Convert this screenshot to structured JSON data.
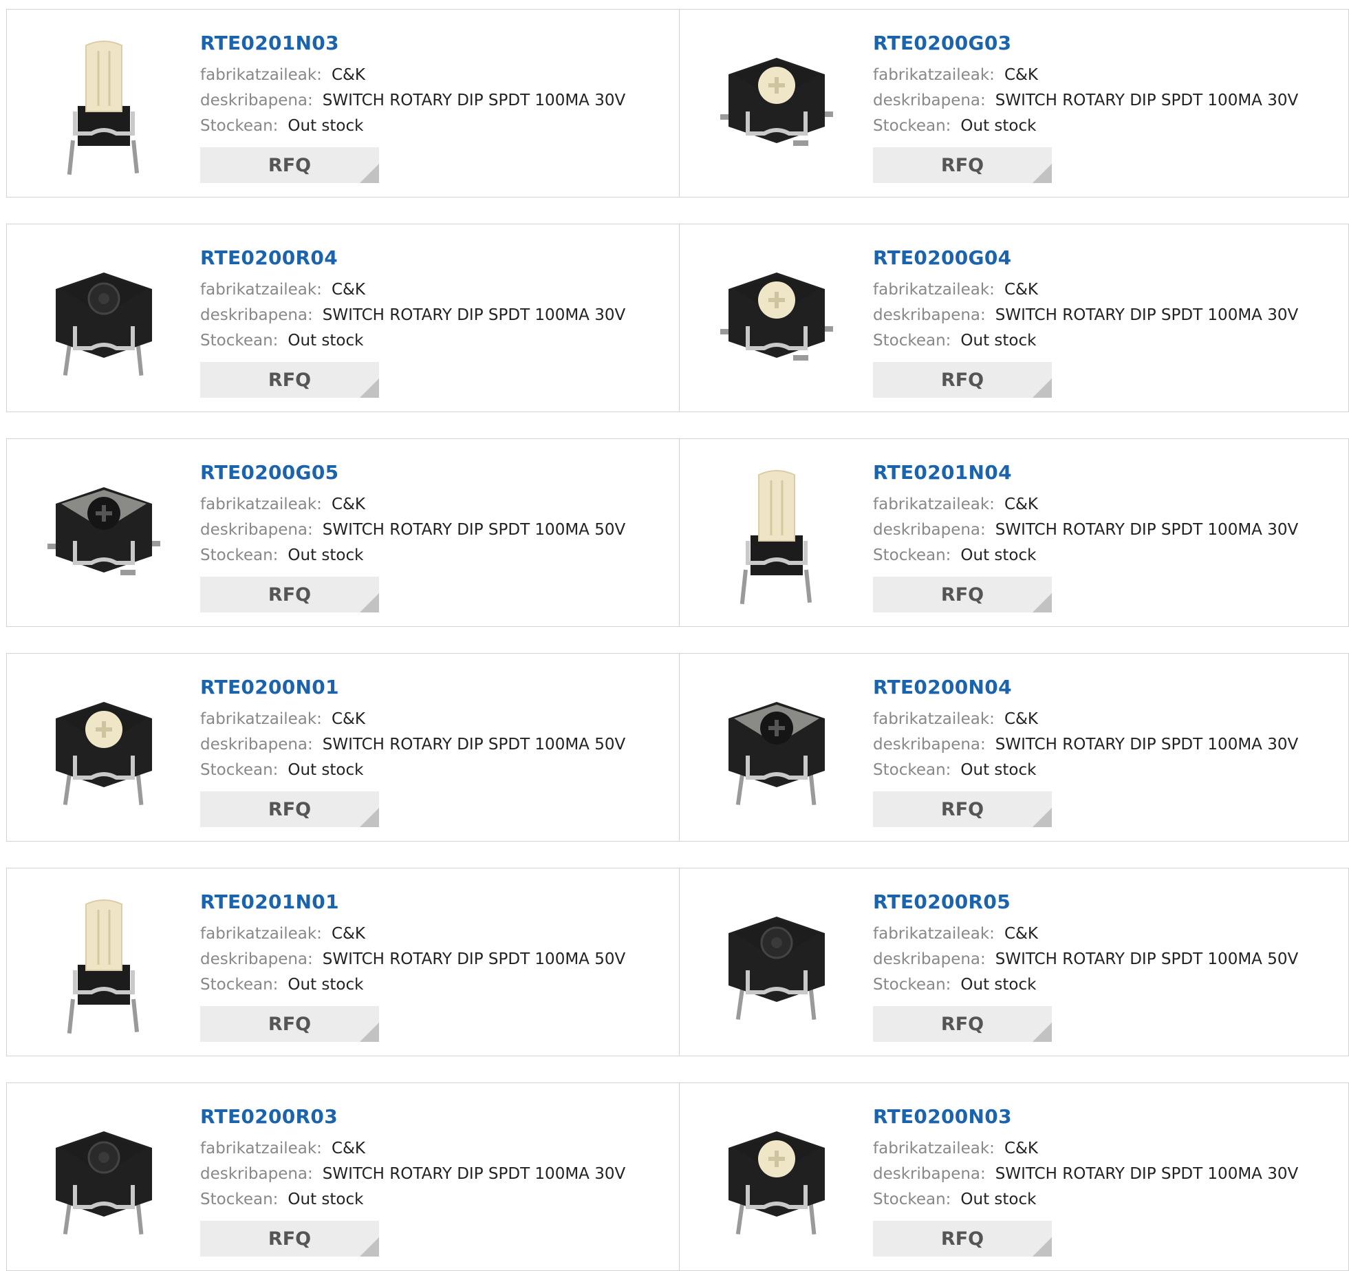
{
  "labels": {
    "manufacturer": "fabrikatzaileak:",
    "description": "deskribapena:",
    "stock": "Stockean:",
    "rfq": "RFQ"
  },
  "products": [
    {
      "pn": "RTE0201N03",
      "mfr": "C&K",
      "desc": "SWITCH ROTARY DIP SPDT 100MA 30V",
      "stock": "Out stock",
      "image": "shaft"
    },
    {
      "pn": "RTE0200G03",
      "mfr": "C&K",
      "desc": "SWITCH ROTARY DIP SPDT 100MA 30V",
      "stock": "Out stock",
      "image": "smd-cream"
    },
    {
      "pn": "RTE0200R04",
      "mfr": "C&K",
      "desc": "SWITCH ROTARY DIP SPDT 100MA 30V",
      "stock": "Out stock",
      "image": "thru-black"
    },
    {
      "pn": "RTE0200G04",
      "mfr": "C&K",
      "desc": "SWITCH ROTARY DIP SPDT 100MA 30V",
      "stock": "Out stock",
      "image": "smd-cream"
    },
    {
      "pn": "RTE0200G05",
      "mfr": "C&K",
      "desc": "SWITCH ROTARY DIP SPDT 100MA 50V",
      "stock": "Out stock",
      "image": "smd-grey"
    },
    {
      "pn": "RTE0201N04",
      "mfr": "C&K",
      "desc": "SWITCH ROTARY DIP SPDT 100MA 30V",
      "stock": "Out stock",
      "image": "shaft"
    },
    {
      "pn": "RTE0200N01",
      "mfr": "C&K",
      "desc": "SWITCH ROTARY DIP SPDT 100MA 50V",
      "stock": "Out stock",
      "image": "thru-cream"
    },
    {
      "pn": "RTE0200N04",
      "mfr": "C&K",
      "desc": "SWITCH ROTARY DIP SPDT 100MA 30V",
      "stock": "Out stock",
      "image": "thru-grey"
    },
    {
      "pn": "RTE0201N01",
      "mfr": "C&K",
      "desc": "SWITCH ROTARY DIP SPDT 100MA 50V",
      "stock": "Out stock",
      "image": "shaft"
    },
    {
      "pn": "RTE0200R05",
      "mfr": "C&K",
      "desc": "SWITCH ROTARY DIP SPDT 100MA 50V",
      "stock": "Out stock",
      "image": "thru-black"
    },
    {
      "pn": "RTE0200R03",
      "mfr": "C&K",
      "desc": "SWITCH ROTARY DIP SPDT 100MA 30V",
      "stock": "Out stock",
      "image": "thru-black"
    },
    {
      "pn": "RTE0200N03",
      "mfr": "C&K",
      "desc": "SWITCH ROTARY DIP SPDT 100MA 30V",
      "stock": "Out stock",
      "image": "thru-cream"
    }
  ]
}
